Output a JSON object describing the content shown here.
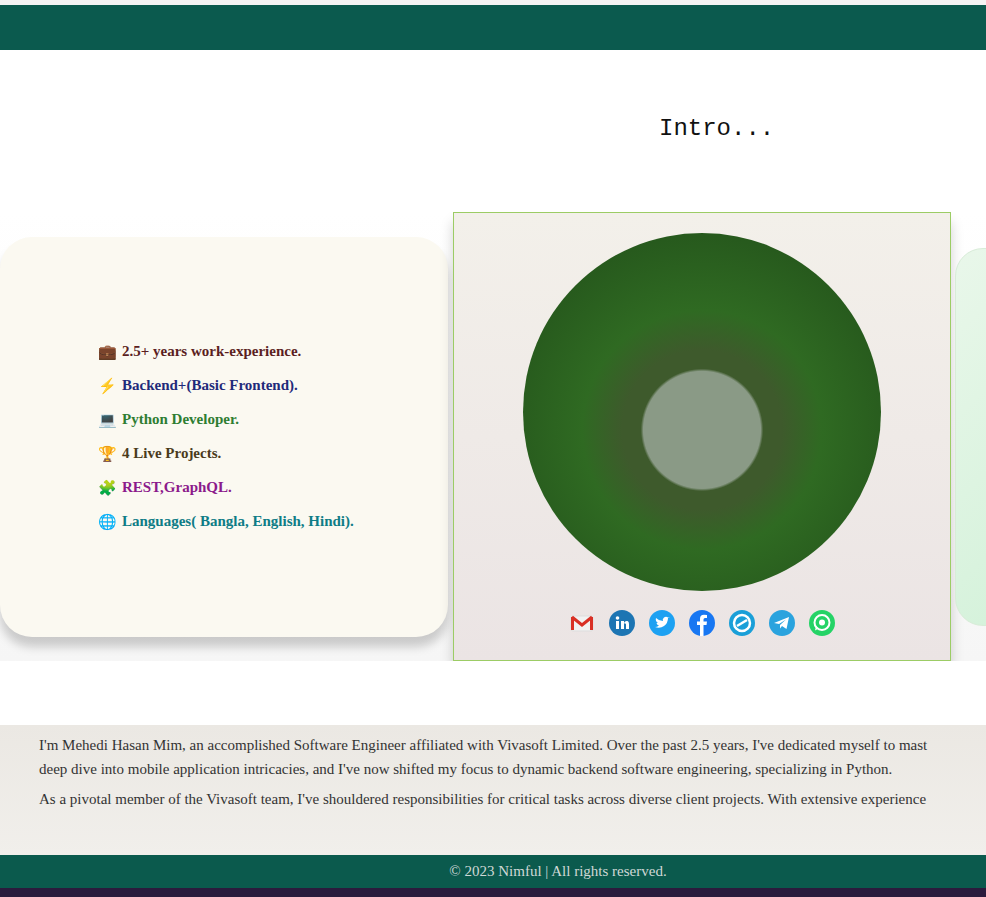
{
  "intro": {
    "title": "Intro..."
  },
  "highlights": [
    {
      "icon": "💼",
      "text": "2.5+ years work-experience.",
      "color": "#5b1f1f"
    },
    {
      "icon": "⚡",
      "text": "Backend+(Basic Frontend).",
      "color": "#1f2a7a"
    },
    {
      "icon": "💻",
      "text": "Python Developer.",
      "color": "#2e7d32"
    },
    {
      "icon": "🏆",
      "text": "4 Live Projects.",
      "color": "#4a3b1c"
    },
    {
      "icon": "🧩",
      "text": "REST,GraphQL.",
      "color": "#8b1a8b"
    },
    {
      "icon": "🌐",
      "text": "Languages( Bangla, English, Hindi).",
      "color": "#0e7c86"
    }
  ],
  "about": {
    "paragraphs": [
      {
        "lines": [
          "I'm Mehedi Hasan Mim, an accomplished Software Engineer affiliated with Vivasoft Limited. Over the past 2.5 years, I've dedicated myself to mast",
          "deep dive into mobile application intricacies, and I've now shifted my focus to dynamic backend software engineering, specializing in Python."
        ]
      },
      {
        "lines": [
          "As a pivotal member of the Vivasoft team, I've shouldered responsibilities for critical tasks across diverse client projects. With extensive experience"
        ]
      }
    ]
  },
  "footer": {
    "text": "© 2023 Nimful | All rights reserved."
  }
}
